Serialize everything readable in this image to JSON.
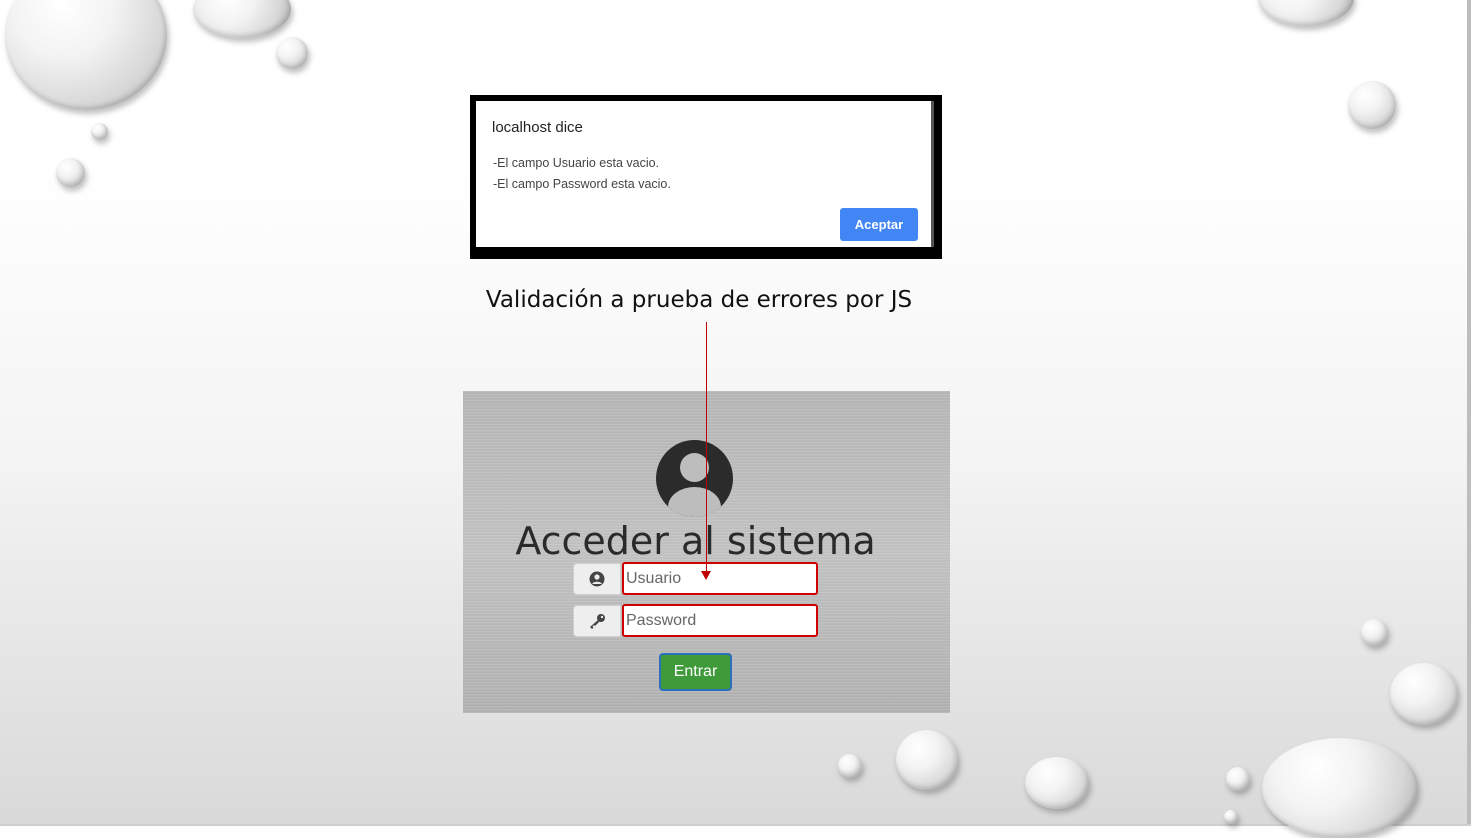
{
  "alert": {
    "title": "localhost dice",
    "messages": [
      "-El campo Usuario esta vacio.",
      "-El campo Password esta vacio."
    ],
    "button_label": "Aceptar",
    "button_color": "#4285f4"
  },
  "caption": "Validación a prueba de errores por JS",
  "login": {
    "title": "Acceder al sistema",
    "user_placeholder": "Usuario",
    "password_placeholder": "Password",
    "user_icon": "user-circle-icon",
    "password_icon": "key-icon",
    "submit_label": "Entrar",
    "error_border_color": "#d00000",
    "submit_color": "#3f9a3a"
  }
}
